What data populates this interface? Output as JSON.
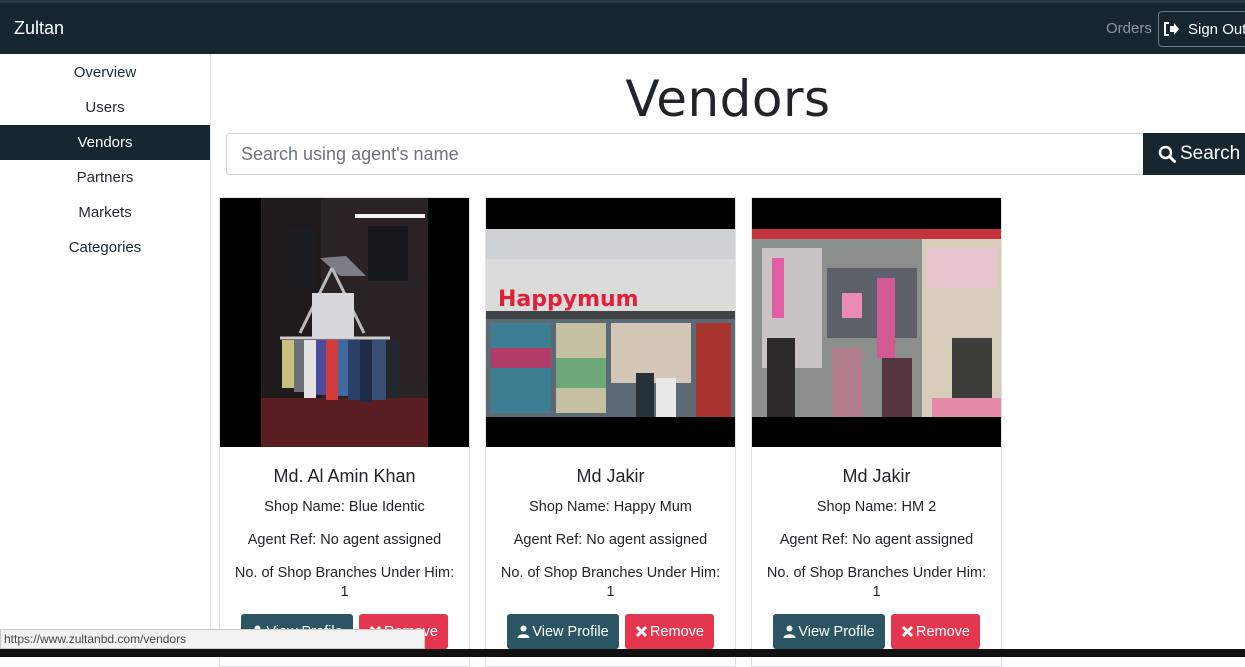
{
  "navbar": {
    "brand": "Zultan",
    "orders_label": "Orders",
    "signout_label": "Sign Out",
    "background": "#15262e"
  },
  "sidebar": {
    "items": [
      {
        "label": "Overview",
        "active": false
      },
      {
        "label": "Users",
        "active": false
      },
      {
        "label": "Vendors",
        "active": true
      },
      {
        "label": "Partners",
        "active": false
      },
      {
        "label": "Markets",
        "active": false
      },
      {
        "label": "Categories",
        "active": false
      }
    ]
  },
  "main": {
    "title": "Vendors",
    "search": {
      "placeholder": "Search using agent's name",
      "value": "",
      "button_label": "Search"
    }
  },
  "vendors": [
    {
      "name": "Md. Al Amin Khan",
      "shop": "Shop Name: Blue Identic",
      "agent": "Agent Ref: No agent assigned",
      "branches": "No. of Shop Branches Under Him: 1",
      "view_label": "View Profile",
      "remove_label": "Remove",
      "image": "clothing-rack-photo"
    },
    {
      "name": "Md Jakir",
      "shop": "Shop Name: Happy Mum",
      "agent": "Agent Ref: No agent assigned",
      "branches": "No. of Shop Branches Under Him: 1",
      "view_label": "View Profile",
      "remove_label": "Remove",
      "image": "happy-mum-storefront-photo",
      "sign_text": "Happymum"
    },
    {
      "name": "Md Jakir",
      "shop": "Shop Name: HM 2",
      "agent": "Agent Ref: No agent assigned",
      "branches": "No. of Shop Branches Under Him: 1",
      "view_label": "View Profile",
      "remove_label": "Remove",
      "image": "hm2-store-interior-photo"
    }
  ],
  "status_bar": {
    "url": "https://www.zultanbd.com/vendors"
  },
  "colors": {
    "view_button": "#2c5563",
    "remove_button": "#e4364e"
  }
}
